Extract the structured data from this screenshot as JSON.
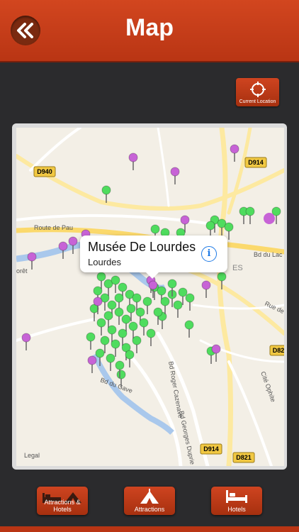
{
  "header": {
    "title": "Map",
    "back_icon": "double-chevron-left-icon"
  },
  "toolbar": {
    "current_location_label": "Current Location",
    "current_location_icon": "crosshair-icon"
  },
  "map": {
    "road_labels": [
      "D940",
      "D914",
      "Route de Pau",
      "Bd du Lac",
      "Rue de",
      "D82",
      "Bd Roger Cazenave",
      "Bd Georges Duprie",
      "Bd du Gave",
      "Cité Ophite",
      "D914",
      "D821",
      "orêt",
      "ES"
    ],
    "legal_label": "Legal",
    "callout": {
      "title": "Musée De Lourdes",
      "subtitle": "Lourdes",
      "info_icon": "info-icon",
      "info_glyph": "i"
    },
    "pin_colors": {
      "attraction": "#4fdc5e",
      "hotel": "#c763d6"
    }
  },
  "tabbar": {
    "items": [
      {
        "label": "Attractions & Hotels",
        "icon": "bed-and-tent-icon"
      },
      {
        "label": "Attractions",
        "icon": "tent-icon"
      },
      {
        "label": "Hotels",
        "icon": "bed-icon"
      }
    ]
  },
  "colors": {
    "brand": "#c13d17",
    "background": "#2b2b2d"
  }
}
